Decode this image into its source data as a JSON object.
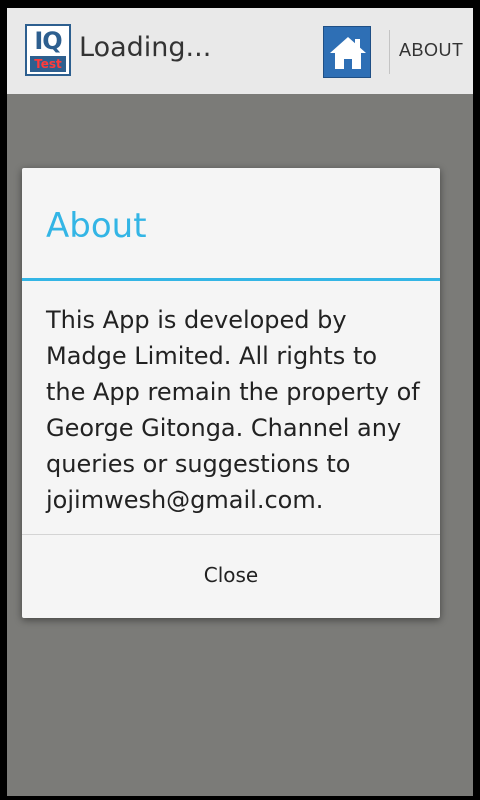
{
  "app": {
    "title": "Loading...",
    "logo_top": "IQ",
    "logo_bottom": "Test"
  },
  "actionbar": {
    "home_icon": "home-icon",
    "about_label": "ABOUT"
  },
  "dialog": {
    "title": "About",
    "message": "This App is developed by Madge Limited. All rights to the App remain the property of George Gitonga. Channel any queries or suggestions to jojimwesh@gmail.com.",
    "close_label": "Close"
  },
  "colors": {
    "accent": "#33b5e5",
    "home_button": "#2e6fb5",
    "scrim": "#7b7b78"
  }
}
